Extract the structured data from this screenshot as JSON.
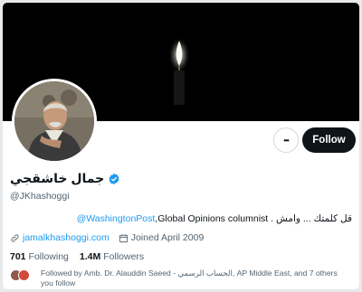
{
  "profile": {
    "display_name": "جمال خاشقجي",
    "handle": "@JKhashoggi",
    "bio_text": "قل كلمتك ... وامش . Global Opinions columnist,",
    "bio_mention": "@WashingtonPost",
    "website": "jamalkhashoggi.com",
    "joined": "Joined April 2009",
    "following_count": "701",
    "following_label": "Following",
    "followers_count": "1.4M",
    "followers_label": "Followers",
    "followed_by_line1": "Followed by Amb. Dr. Alauddin Saeed - الحساب الرسمي, AP Middle East, and 7 others",
    "followed_by_line2": "you follow"
  },
  "actions": {
    "more_label": "•••",
    "follow_label": "Follow"
  },
  "icons": {
    "verified": "verified-badge-icon",
    "link": "link-icon",
    "calendar": "calendar-icon",
    "more": "more-icon"
  },
  "colors": {
    "accent": "#1d9bf0",
    "follow_button": "#0f1419",
    "banner": "#000000",
    "muted_text": "#536471"
  }
}
